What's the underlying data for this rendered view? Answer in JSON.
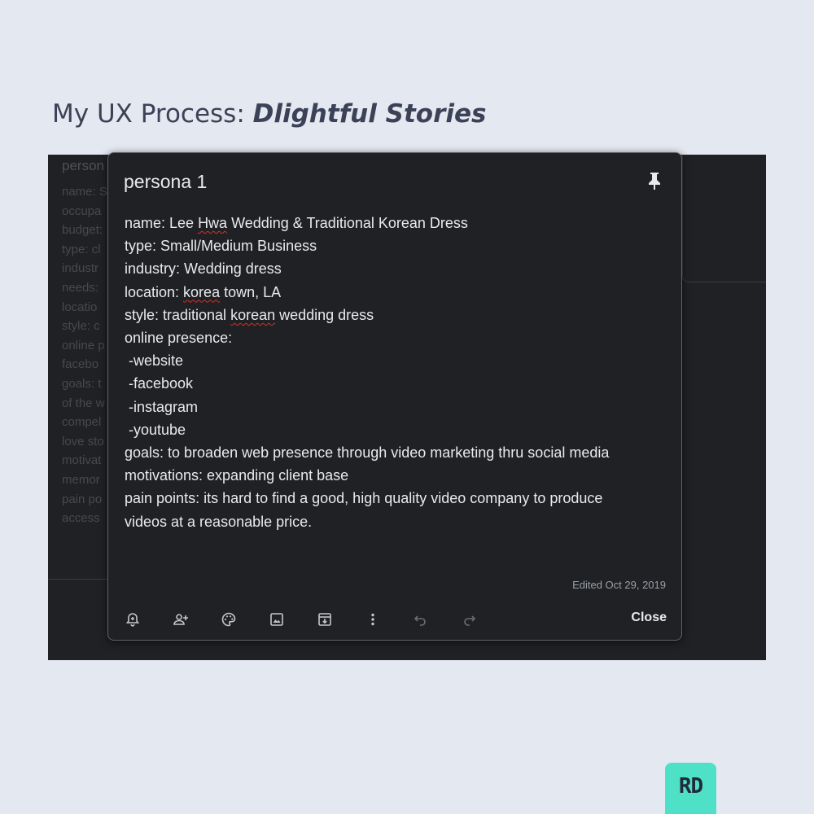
{
  "heading": {
    "prefix": "My UX Process: ",
    "emphasis": "Dlightful Stories"
  },
  "background_card": {
    "title": "person",
    "lines": [
      "name: S",
      "occupa",
      "budget:",
      "type: cl",
      "industr",
      "needs: ",
      "locatio",
      "style: c",
      "online p",
      "facebo",
      "goals: t",
      "of the w",
      "compel",
      "love sto",
      "motivat",
      "memor",
      "pain po",
      "access"
    ]
  },
  "note": {
    "title": "persona 1",
    "lines": [
      [
        {
          "t": "name: Lee "
        },
        {
          "t": "Hwa",
          "spell": true
        },
        {
          "t": " Wedding & Traditional Korean Dress"
        }
      ],
      [
        {
          "t": "type: Small/Medium Business"
        }
      ],
      [
        {
          "t": "industry: Wedding dress"
        }
      ],
      [
        {
          "t": "location: "
        },
        {
          "t": "korea",
          "spell": true
        },
        {
          "t": " town, LA"
        }
      ],
      [
        {
          "t": "style: traditional "
        },
        {
          "t": "korean",
          "spell": true
        },
        {
          "t": " wedding dress"
        }
      ],
      [
        {
          "t": "online presence:"
        }
      ],
      [
        {
          "t": " -website"
        }
      ],
      [
        {
          "t": " -facebook"
        }
      ],
      [
        {
          "t": " -instagram"
        }
      ],
      [
        {
          "t": " -youtube"
        }
      ],
      [
        {
          "t": "goals: to broaden web presence through video marketing thru social media"
        }
      ],
      [
        {
          "t": "motivations: expanding client base"
        }
      ],
      [
        {
          "t": "pain points: its hard to find a good, high quality video company to produce"
        }
      ],
      [
        {
          "t": "videos at a reasonable price."
        }
      ]
    ],
    "edited": "Edited Oct 29, 2019",
    "close_label": "Close"
  },
  "toolbar_icons": [
    "remind-me-icon",
    "collaborator-icon",
    "palette-icon",
    "image-icon",
    "archive-icon",
    "more-icon",
    "undo-icon",
    "redo-icon"
  ],
  "colors": {
    "page_bg": "#e4e8f0",
    "note_bg": "#202124",
    "text": "#e8eaed",
    "muted": "#9aa0a6",
    "badge": "#4fe0c8"
  },
  "badge": {
    "label": "RD"
  }
}
